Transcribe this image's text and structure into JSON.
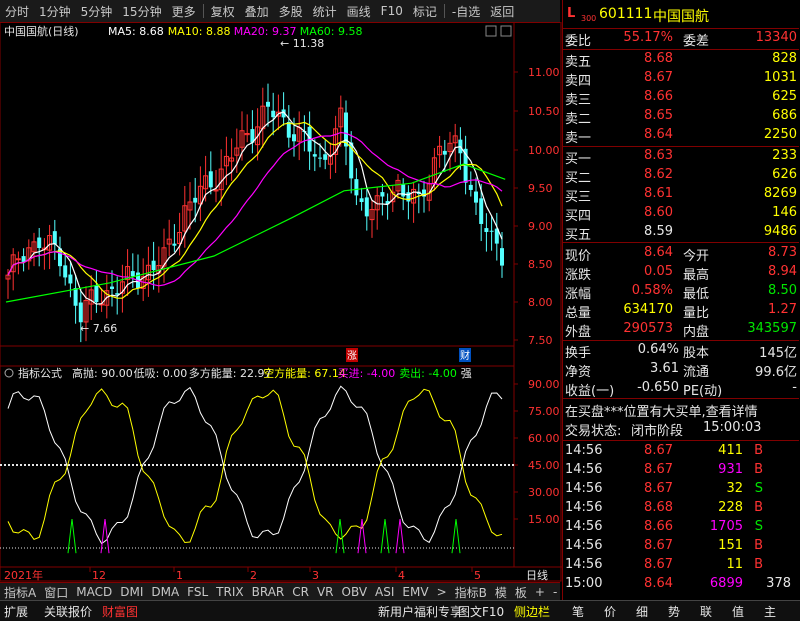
{
  "toolbar": {
    "items": [
      "分时",
      "1分钟",
      "5分钟",
      "15分钟",
      "更多",
      "复权",
      "叠加",
      "多股",
      "统计",
      "画线",
      "F10",
      "标记",
      "-自选",
      "返回"
    ]
  },
  "chart": {
    "name": "中国国航(日线)",
    "ma": [
      {
        "label": "MA5: 8.68",
        "color": "#ffffff"
      },
      {
        "label": "MA10: 8.88",
        "color": "#ffff00"
      },
      {
        "label": "MA20: 9.37",
        "color": "#ff00ff"
      },
      {
        "label": "MA60: 9.58",
        "color": "#00ff00"
      }
    ],
    "yticks": [
      {
        "v": "11.00",
        "y": 72
      },
      {
        "v": "10.50",
        "y": 111
      },
      {
        "v": "10.00",
        "y": 150
      },
      {
        "v": "9.50",
        "y": 188
      },
      {
        "v": "9.00",
        "y": 226
      },
      {
        "v": "8.50",
        "y": 264
      },
      {
        "v": "8.00",
        "y": 302
      },
      {
        "v": "7.50",
        "y": 340
      }
    ],
    "high_label": "11.38",
    "low_label": "7.66",
    "marks": {
      "zhang": "涨",
      "cai": "财"
    }
  },
  "indicator": {
    "title": "指标公式",
    "items": [
      {
        "label": "高抛: 90.00",
        "color": "#e6e6e6"
      },
      {
        "label": "低吸: 0.00",
        "color": "#e6e6e6"
      },
      {
        "label": "多方能量: 22.97",
        "color": "#e6e6e6"
      },
      {
        "label": "空方能量: 67.14",
        "color": "#ffff00"
      },
      {
        "label": "买进: -4.00",
        "color": "#ff00ff"
      },
      {
        "label": "卖出: -4.00",
        "color": "#00ff00"
      },
      {
        "label": "强",
        "color": "#e6e6e6"
      }
    ],
    "yticks": [
      "90.00",
      "75.00",
      "60.00",
      "45.00",
      "30.00",
      "15.00"
    ]
  },
  "xaxis": {
    "labels": [
      "2021年",
      "12",
      "1",
      "2",
      "3",
      "4",
      "5"
    ],
    "period": "日线"
  },
  "bottom_tabs": [
    "指标A",
    "窗口",
    "MACD",
    "DMI",
    "DMA",
    "FSL",
    "TRIX",
    "BRAR",
    "CR",
    "VR",
    "OBV",
    "ASI",
    "EMV",
    ">",
    "指标B",
    "模",
    "板",
    "+",
    "-"
  ],
  "status_bar": {
    "left": [
      "扩展",
      "关联报价",
      "财富图"
    ],
    "mid": "新用户福利专享",
    "mid2": "图文F10",
    "mid3": "侧边栏",
    "right": [
      "笔",
      "价",
      "细",
      "势",
      "联",
      "值",
      "主"
    ]
  },
  "quote": {
    "badge": "L",
    "badge_sub": "300",
    "code": "601111",
    "name": "中国国航",
    "weibi_label": "委比",
    "weibi": "55.17%",
    "weicha_label": "委差",
    "weicha": "13340",
    "asks": [
      {
        "l": "卖五",
        "p": "8.68",
        "v": "828"
      },
      {
        "l": "卖四",
        "p": "8.67",
        "v": "1031"
      },
      {
        "l": "卖三",
        "p": "8.66",
        "v": "625"
      },
      {
        "l": "卖二",
        "p": "8.65",
        "v": "686"
      },
      {
        "l": "卖一",
        "p": "8.64",
        "v": "2250"
      }
    ],
    "bids": [
      {
        "l": "买一",
        "p": "8.63",
        "v": "233"
      },
      {
        "l": "买二",
        "p": "8.62",
        "v": "626"
      },
      {
        "l": "买三",
        "p": "8.61",
        "v": "8269"
      },
      {
        "l": "买四",
        "p": "8.60",
        "v": "146"
      },
      {
        "l": "买五",
        "p": "8.59",
        "v": "9486"
      }
    ],
    "stats": [
      {
        "a": "现价",
        "av": "8.64",
        "ac": "red",
        "b": "今开",
        "bv": "8.73",
        "bc": "red"
      },
      {
        "a": "涨跌",
        "av": "0.05",
        "ac": "red",
        "b": "最高",
        "bv": "8.94",
        "bc": "red"
      },
      {
        "a": "涨幅",
        "av": "0.58%",
        "ac": "red",
        "b": "最低",
        "bv": "8.50",
        "bc": "green"
      },
      {
        "a": "总量",
        "av": "634170",
        "ac": "yellow",
        "b": "量比",
        "bv": "1.27",
        "bc": "red"
      },
      {
        "a": "外盘",
        "av": "290573",
        "ac": "red",
        "b": "内盘",
        "bv": "343597",
        "bc": "green"
      }
    ],
    "stats2": [
      {
        "a": "换手",
        "av": "0.64%",
        "b": "股本",
        "bv": "145亿"
      },
      {
        "a": "净资",
        "av": "3.61",
        "b": "流通",
        "bv": "99.6亿"
      },
      {
        "a": "收益(一)",
        "av": "-0.650",
        "b": "PE(动)",
        "bv": "-"
      }
    ],
    "notice": "在买盘***位置有大买单,查看详情",
    "trade_status_label": "交易状态:",
    "trade_status": "闭市阶段",
    "trade_time": "15:00:03",
    "ticks": [
      {
        "t": "14:56",
        "p": "8.67",
        "v": "411",
        "vc": "yellow",
        "d": "B",
        "dc": "red"
      },
      {
        "t": "14:56",
        "p": "8.67",
        "v": "931",
        "vc": "mag",
        "d": "B",
        "dc": "red"
      },
      {
        "t": "14:56",
        "p": "8.67",
        "v": "32",
        "vc": "yellow",
        "d": "S",
        "dc": "green"
      },
      {
        "t": "14:56",
        "p": "8.68",
        "v": "228",
        "vc": "yellow",
        "d": "B",
        "dc": "red"
      },
      {
        "t": "14:56",
        "p": "8.66",
        "v": "1705",
        "vc": "mag",
        "d": "S",
        "dc": "green"
      },
      {
        "t": "14:56",
        "p": "8.67",
        "v": "151",
        "vc": "yellow",
        "d": "B",
        "dc": "red"
      },
      {
        "t": "14:56",
        "p": "8.67",
        "v": "11",
        "vc": "yellow",
        "d": "B",
        "dc": "red"
      },
      {
        "t": "15:00",
        "p": "8.64",
        "v": "6899",
        "vc": "mag",
        "d": "378",
        "dc": "white"
      }
    ]
  }
}
